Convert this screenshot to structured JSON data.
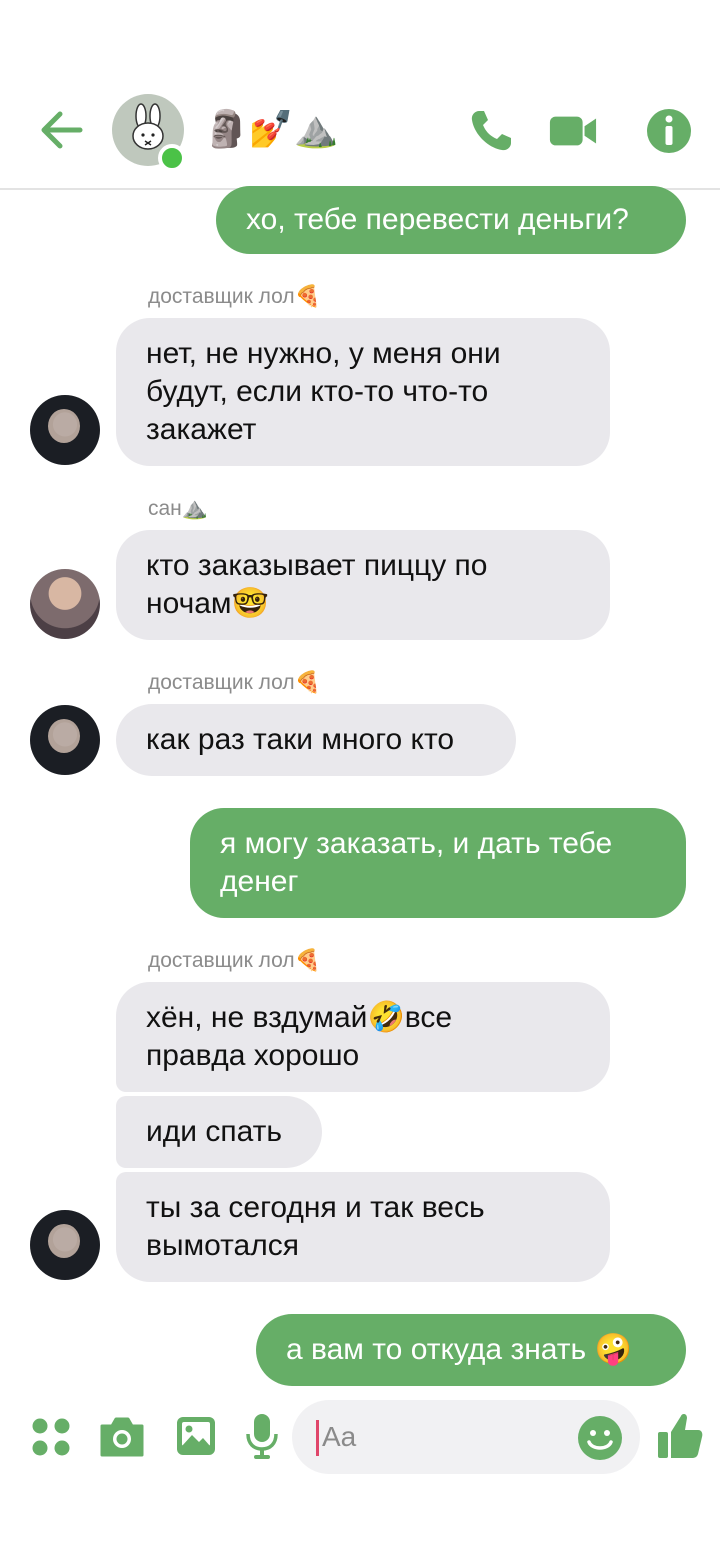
{
  "header": {
    "title": "🗿💅⛰️",
    "accent": "#66ae67",
    "online_color": "#4bc247"
  },
  "messages": [
    {
      "dir": "out",
      "text": "хо, тебе перевести деньги?"
    },
    {
      "dir": "in",
      "sender": "доставщик лол🍕",
      "text": "нет, не нужно, у меня они\nбудут, если кто-то что-то\nзакажет"
    },
    {
      "dir": "in",
      "sender": "сан⛰️",
      "text": "кто заказывает пиццу по\nночам🤓"
    },
    {
      "dir": "in",
      "sender": "доставщик лол🍕",
      "text": "как раз таки много кто"
    },
    {
      "dir": "out",
      "text": "я могу заказать, и дать тебе\nденег"
    },
    {
      "dir": "in",
      "sender": "доставщик лол🍕",
      "text": "хён, не вздумай🤣все\nправда хорошо"
    },
    {
      "dir": "in",
      "text": "иди спать"
    },
    {
      "dir": "in",
      "text": "ты за сегодня и так весь\nвымотался"
    },
    {
      "dir": "out",
      "text": "а вам то откуда знать 🤪"
    }
  ],
  "composer": {
    "placeholder": "Aa"
  },
  "colors": {
    "incoming_bubble": "#e9e8ec",
    "outgoing_bubble": "#66ae67"
  }
}
